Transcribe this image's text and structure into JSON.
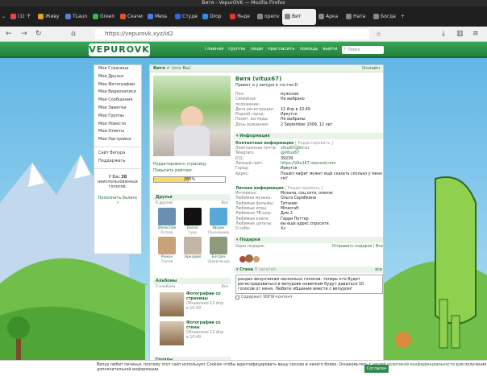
{
  "window": {
    "title": "Витя - VepurOVK — Mozilla Firefox"
  },
  "tabs": [
    {
      "label": "(1) ‘F",
      "color": "#e24a4a"
    },
    {
      "label": "Живу",
      "color": "#e5a02a"
    },
    {
      "label": "TLaun",
      "color": "#5a7fd8"
    },
    {
      "label": "Green",
      "color": "#3ab54a"
    },
    {
      "label": "Скачи",
      "color": "#e2542d"
    },
    {
      "label": "Mess",
      "color": "#4a7be5"
    },
    {
      "label": "Студе",
      "color": "#2b6ad8"
    },
    {
      "label": "Drop",
      "color": "#2f8fe5"
    },
    {
      "label": "Янде",
      "color": "#e23a2a"
    },
    {
      "label": "openv",
      "color": "#888888"
    },
    {
      "label": "Вит",
      "color": "#888888",
      "active": true
    },
    {
      "label": "Арка",
      "color": "#888888"
    },
    {
      "label": "Ната",
      "color": "#888888"
    },
    {
      "label": "Богда",
      "color": "#888888"
    }
  ],
  "url": "https://vepurovk.xyz/id2",
  "site": {
    "logo": "VEPUROVK",
    "menu": [
      "главная",
      "группы",
      "люди",
      "пригласить",
      "помощь",
      "выйти"
    ],
    "search_placeholder": "Поиск"
  },
  "leftmenu": {
    "items": [
      "Моя Страница",
      "Мои Друзья",
      "Мои Фотографии",
      "Мои Видеозаписи",
      "Мои Сообщения",
      "Мои Заметки",
      "Мои Группы",
      "Мои Новости",
      "Мои Ответы",
      "Мои Настройки"
    ],
    "extra": [
      "Сайт Вепура",
      "Поддержать"
    ],
    "vote_text_1": "У Вас",
    "vote_count": "38",
    "vote_text_2": "неиспользованных голосов.",
    "vote_link": "Пополнить баланс »"
  },
  "profile": {
    "header_name": "Витя",
    "header_status": "(это Вы)",
    "online": "Онлайн",
    "name": "Витя (vitux67)",
    "status": "Привет я у вепура в гостях:D",
    "edit_link": "Редактировать страницу",
    "rating_link": "Повысить рейтинг",
    "rating": "285%",
    "rating_fraction": 0.5
  },
  "basic_info": [
    {
      "k": "Пол:",
      "v": "мужской"
    },
    {
      "k": "Семейное положение:",
      "v": "Не выбрано"
    },
    {
      "k": "Дата регистрации:",
      "v": "12 Апр в 10:49"
    },
    {
      "k": "Родной город:",
      "v": "Иркутск"
    },
    {
      "k": "Полит. взгляды:",
      "v": "Не выбраны"
    },
    {
      "k": "День рождения:",
      "v": "2 September 2009, 12 лет"
    }
  ],
  "info_title": "Информация",
  "contacts": {
    "title": "Контактная информация",
    "edit": "[ Редактировать ]",
    "rows": [
      {
        "k": "Электронная почта:",
        "v": "vitux67@inl.ru",
        "link": true
      },
      {
        "k": "Telegram:",
        "v": "@Vitux67",
        "link": true
      },
      {
        "k": "ICQ:",
        "v": "39239",
        "link": false
      },
      {
        "k": "Личный сайт:",
        "v": "https://Vitu167.neocord.com",
        "link": true
      },
      {
        "k": "Город:",
        "v": "Иркутск",
        "link": false
      },
      {
        "k": "Адрес:",
        "v": "Пошёл нафиг может ещё сказать сколько у меня см?",
        "link": false
      }
    ]
  },
  "personal": {
    "title": "Личная информация",
    "edit": "[ Редактировать ]",
    "rows": [
      {
        "k": "Интересы:",
        "v": "Музыка, соц.сети, оленях"
      },
      {
        "k": "Любимая музыка:",
        "v": "Ольга Серябкина"
      },
      {
        "k": "Любимые фильмы:",
        "v": "Титаник"
      },
      {
        "k": "Любимые игры:",
        "v": "Minecraft"
      },
      {
        "k": "Любимые ТВ-шоу:",
        "v": "Дом 2"
      },
      {
        "k": "Любимые книги:",
        "v": "Гарри Поттер"
      },
      {
        "k": "Любимые цитаты:",
        "v": "вы ещё адрес спросите."
      },
      {
        "k": "О себе:",
        "v": "Хз"
      }
    ]
  },
  "friends": {
    "title": "Друзья",
    "count": "6 друзей",
    "all": "Все",
    "list": [
      {
        "name": "Вячеслав",
        "sub": "Петров",
        "color": "#6a8fb0"
      },
      {
        "name": "Бесон",
        "sub": "Суда",
        "color": "#111111"
      },
      {
        "name": "Ирдан",
        "sub": "Пономарева",
        "color": "#56a8d6"
      },
      {
        "name": "Роман",
        "sub": "Ткачев",
        "color": "#c9a27a"
      },
      {
        "name": "Аркадий",
        "sub": "",
        "color": "#c4b6a4"
      },
      {
        "name": "Богдан",
        "sub": "Задорожный",
        "color": "#8a9c7c"
      }
    ]
  },
  "albums": {
    "title": "Альбомы",
    "count": "2 альбома",
    "all": "Все",
    "list": [
      {
        "name": "Фотографии со страницы",
        "meta": "Обновлено 12 Апр в 10:49"
      },
      {
        "name": "Фотографии со стены",
        "meta": "Обновлено 12 Апр в 10:49"
      }
    ]
  },
  "groups_title": "Группы",
  "gifts": {
    "title": "Подарки",
    "count": "Один подарок",
    "send": "Отправить подарок",
    "all": "Все"
  },
  "wall": {
    "title": "Стена",
    "count": "8 записей",
    "all": "все",
    "text": "раздал везунчикам несколько голосов. теперь кто будет регистрироваться в вепуровк новичкам будут даваться 10 голосов от меня. Любите общение вместе с вепуром!",
    "nsfw": "Содержит NSFW-контент",
    "publish": "Опубликовать"
  },
  "cookie": {
    "text": "Вепур любит печенья, поэтому этот сайт использует Cookies чтобы идентифицировать вашу сессию и ничего более. Ознакомьтесь с нашей",
    "link": "политикой конфиденциальности",
    "text2": "для получения дополнительной информации.",
    "accept": "Согласен"
  }
}
